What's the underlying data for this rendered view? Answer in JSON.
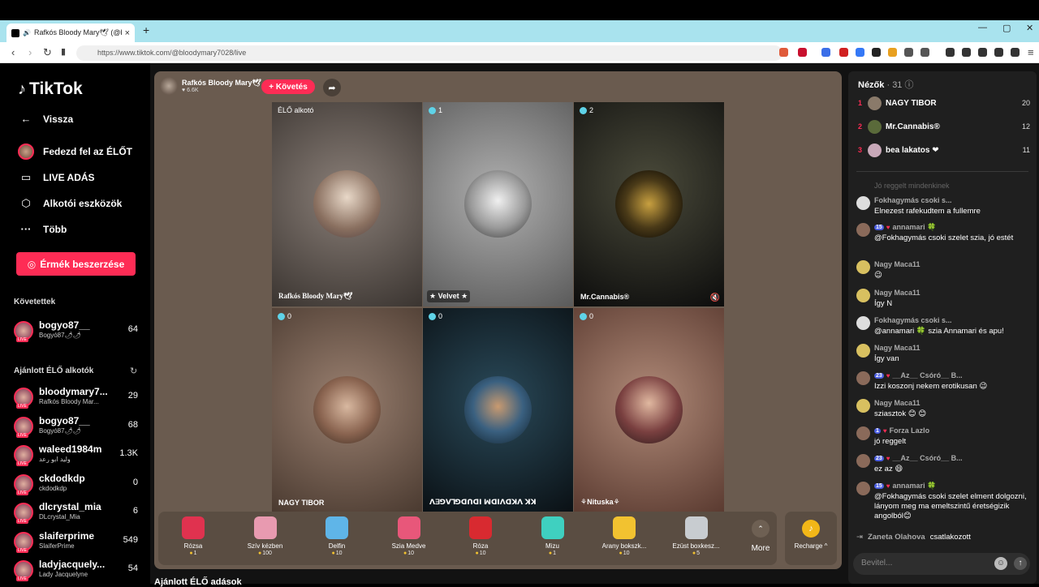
{
  "browser": {
    "tab_title": "Rafkós Bloody Mary🕊 (@blo",
    "url": "https://www.tiktok.com/@bloodymary7028/live"
  },
  "sidebar": {
    "logo": "TikTok",
    "nav": [
      {
        "label": "Vissza",
        "icon": "←"
      },
      {
        "label": "Fedezd fel az ÉLŐT",
        "icon": "avatar"
      },
      {
        "label": "LIVE ADÁS",
        "icon": "▭"
      },
      {
        "label": "Alkotói eszközök",
        "icon": "⬡"
      },
      {
        "label": "Több",
        "icon": "···"
      }
    ],
    "coin_button": "Érmék beszerzése",
    "following_header": "Követettek",
    "following": [
      {
        "name": "bogyo87__",
        "sub": "Bogyó87🌶🌶",
        "count": "64"
      }
    ],
    "recommended_header": "Ajánlott ÉLŐ alkotók",
    "recommended": [
      {
        "name": "bloodymary7...",
        "sub": "Rafkós Bloody Mar...",
        "count": "29"
      },
      {
        "name": "bogyo87__",
        "sub": "Bogyó87🌶🌶",
        "count": "68"
      },
      {
        "name": "waleed1984m",
        "sub": "وليد ابو رعد",
        "count": "1.3K"
      },
      {
        "name": "ckdodkdp",
        "sub": "ckdodkdp",
        "count": "0"
      },
      {
        "name": "dlcrystal_mia",
        "sub": "DLcrystal_Mia",
        "count": "6"
      },
      {
        "name": "slaiferprime",
        "sub": "SlaiferPrime",
        "count": "549"
      },
      {
        "name": "ladyjacquely...",
        "sub": "Lady Jacquelyne",
        "count": "54"
      }
    ]
  },
  "stage": {
    "host_name": "Rafkós Bloody Mary🕊",
    "host_likes": "♥ 6.6K",
    "follow_label": "+ Követés",
    "cells": [
      {
        "badge": "ÉLŐ alkotó",
        "label": "Rafkós Bloody Mary🕊"
      },
      {
        "badge": "1",
        "label": "★ Velvet ★"
      },
      {
        "badge": "2",
        "label": "Mr.Cannabis®"
      },
      {
        "badge": "0",
        "label": "NAGY TIBOR"
      },
      {
        "badge": "0",
        "label": "ꓥƎꓨꓦꓶꓨꓷꓵꓷꓲ ꟽꓷꓲꓥꓷꓘꓥ ꓘꓘ"
      },
      {
        "badge": "0",
        "label": "⚘Nituska⚘"
      }
    ],
    "gifts": [
      {
        "name": "Rózsa",
        "price": "1",
        "color": "#e0324f"
      },
      {
        "name": "Szív kézben",
        "price": "100",
        "color": "#e89ab0"
      },
      {
        "name": "Delfin",
        "price": "10",
        "color": "#5fb5e8"
      },
      {
        "name": "Szia Medve",
        "price": "10",
        "color": "#e8577a"
      },
      {
        "name": "Róza",
        "price": "10",
        "color": "#d82a30"
      },
      {
        "name": "Mizu",
        "price": "1",
        "color": "#3fd0c0"
      },
      {
        "name": "Arany bokszk...",
        "price": "10",
        "color": "#f2c230"
      },
      {
        "name": "Ezüst boxkesz...",
        "price": "5",
        "color": "#c8ccd0"
      }
    ],
    "more_label": "More",
    "recharge_label": "Recharge ^"
  },
  "bottom_text": "Ajánlott ÉLŐ adások",
  "chat": {
    "viewers_label": "Nézők",
    "viewers_count": "· 31 ⓘ",
    "top_viewers": [
      {
        "rank": "1",
        "name": "NAGY TIBOR",
        "score": "20"
      },
      {
        "rank": "2",
        "name": "Mr.Cannabis®",
        "score": "12"
      },
      {
        "rank": "3",
        "name": "bea lakatos ❤",
        "score": "11"
      }
    ],
    "cutoff": "Jó reggelt mindenkinek",
    "messages": [
      {
        "user": "Fokhagymás csoki s...",
        "level": "",
        "text": "Elnezest rafekudtem a fullemre"
      },
      {
        "user": "annamari 🍀",
        "level": "15",
        "text": "@Fokhagymás csoki szelet szia, jó estét"
      },
      {
        "user": "Nagy Maca11",
        "level": "",
        "text": "😉"
      },
      {
        "user": "Nagy Maca11",
        "level": "",
        "text": "Így N"
      },
      {
        "user": "Fokhagymás csoki s...",
        "level": "",
        "text": "@annamari 🍀 szia Annamari és apu!"
      },
      {
        "user": "Nagy Maca11",
        "level": "",
        "text": "Így van"
      },
      {
        "user": "__Az__ Csóró__ B...",
        "level": "23",
        "text": "Izzi koszonj nekem erotikusan 😉"
      },
      {
        "user": "Nagy Maca11",
        "level": "",
        "text": "sziasztok 😊 😊"
      },
      {
        "user": "Forza Lazlo",
        "level": "1",
        "text": "jó reggelt"
      },
      {
        "user": "__Az__ Csóró__ B...",
        "level": "23",
        "text": "ez az 😄"
      },
      {
        "user": "annamari 🍀",
        "level": "15",
        "text": "@Fokhagymás csoki szelet elment dolgozni, lányom meg ma emeltszintű éretségizik angolból😊"
      }
    ],
    "join_user": "Zaneta Olahova",
    "join_text": "csatlakozott",
    "input_placeholder": "Bevitel..."
  }
}
